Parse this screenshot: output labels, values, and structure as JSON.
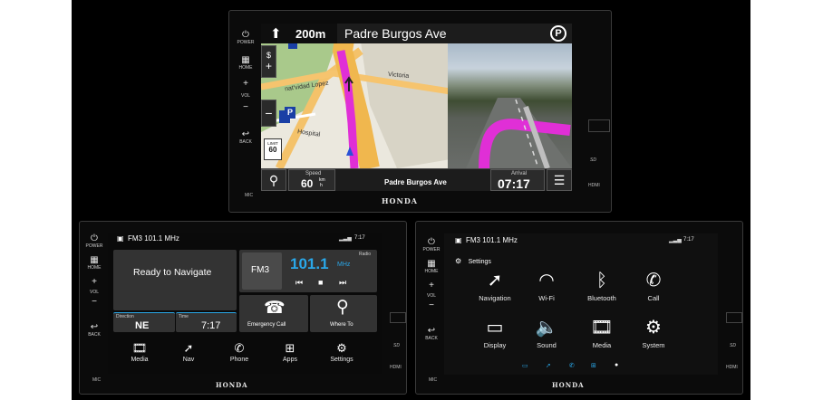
{
  "colors": {
    "route": "#e02fd6",
    "accent": "#2aa7e8",
    "tile": "#333333",
    "bar": "#1c1c1c"
  },
  "head_unit": {
    "power": "POWER",
    "home": "HOME",
    "vol": "VOL",
    "back": "BACK",
    "mic": "MIC",
    "brand": "HONDA",
    "sd": "SD",
    "hdmi": "HDMI",
    "icons": {
      "power": "power-icon",
      "home": "home-grid-icon",
      "plus": "+",
      "minus": "−",
      "back": "back-arrow-icon"
    }
  },
  "navigation": {
    "distance": "200m",
    "street": "Padre Burgos Ave",
    "parking": "P",
    "map_labels": [
      "nat'vidad Lopez",
      "Victoria",
      "Hospital"
    ],
    "limit_label": "LIMIT",
    "limit_value": "60",
    "speed_label": "Speed",
    "speed_value": "60",
    "speed_unit_top": "km",
    "speed_unit_bottom": "h",
    "bottom_street": "Padre Burgos Ave",
    "arrival_label": "Arrival",
    "arrival_time": "07:17"
  },
  "home_screen": {
    "station": "FM3 101.1 MHz",
    "clock": "7:17",
    "nav_status": "Ready to Navigate",
    "direction_label": "Direction",
    "direction_value": "NE",
    "time_label": "Time",
    "time_value": "7:17",
    "radio_label": "Radio",
    "band": "FM3",
    "frequency": "101.1",
    "freq_unit": "MHz",
    "emergency": "Emergency Call",
    "where_to": "Where To",
    "dock": [
      "Media",
      "Nav",
      "Phone",
      "Apps",
      "Settings"
    ]
  },
  "settings_screen": {
    "station": "FM3 101.1 MHz",
    "clock": "7:17",
    "title": "Settings",
    "items": [
      "Navigation",
      "Wi-Fi",
      "Bluetooth",
      "Call",
      "Display",
      "Sound",
      "Media",
      "System"
    ]
  }
}
